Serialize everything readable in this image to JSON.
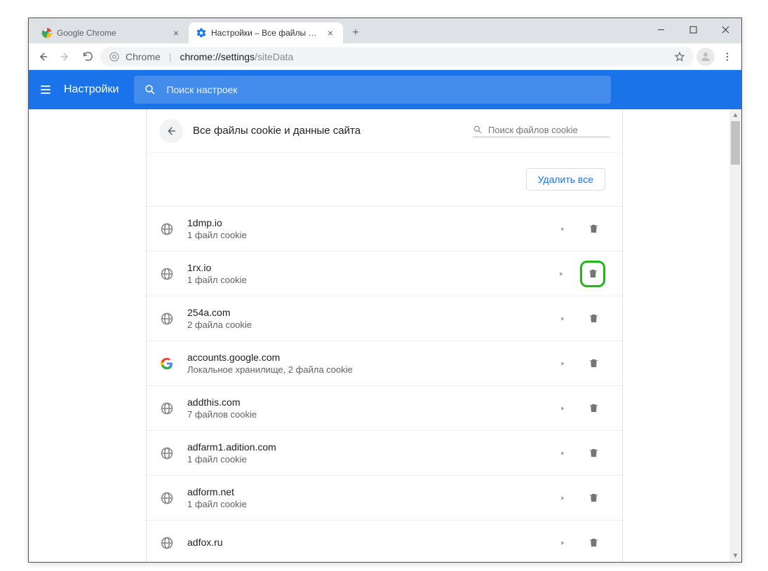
{
  "tabs": [
    {
      "title": "Google Chrome",
      "active": false
    },
    {
      "title": "Настройки – Все файлы cookie",
      "active": true
    }
  ],
  "omnibox": {
    "prefix": "Chrome",
    "host": "chrome://settings",
    "path": "/siteData"
  },
  "settings": {
    "title": "Настройки",
    "search_placeholder": "Поиск настроек"
  },
  "card": {
    "title": "Все файлы cookie и данные сайта",
    "cookie_search_placeholder": "Поиск файлов cookie",
    "remove_all_label": "Удалить все"
  },
  "sites": [
    {
      "domain": "1dmp.io",
      "detail": "1 файл cookie",
      "icon": "globe",
      "highlight": false
    },
    {
      "domain": "1rx.io",
      "detail": "1 файл cookie",
      "icon": "globe",
      "highlight": true
    },
    {
      "domain": "254a.com",
      "detail": "2 файла cookie",
      "icon": "globe",
      "highlight": false
    },
    {
      "domain": "accounts.google.com",
      "detail": "Локальное хранилище, 2 файла cookie",
      "icon": "google",
      "highlight": false
    },
    {
      "domain": "addthis.com",
      "detail": "7 файлов cookie",
      "icon": "globe",
      "highlight": false
    },
    {
      "domain": "adfarm1.adition.com",
      "detail": "1 файл cookie",
      "icon": "globe",
      "highlight": false
    },
    {
      "domain": "adform.net",
      "detail": "1 файл cookie",
      "icon": "globe",
      "highlight": false
    },
    {
      "domain": "adfox.ru",
      "detail": "",
      "icon": "globe",
      "highlight": false
    }
  ]
}
